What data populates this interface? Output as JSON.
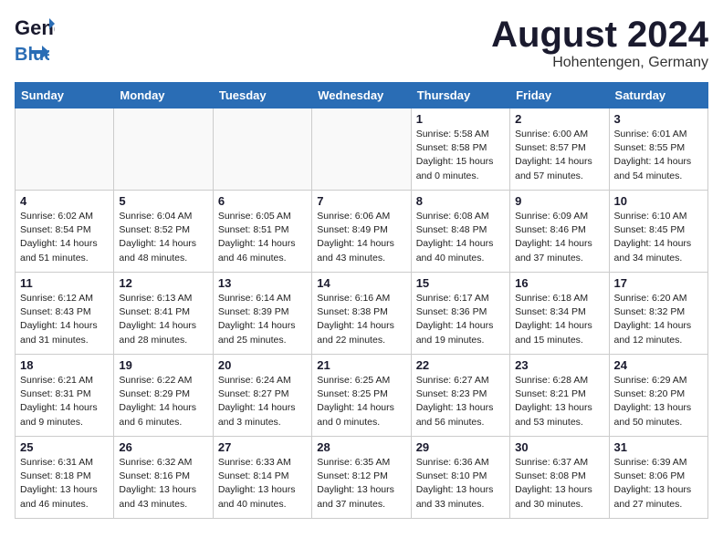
{
  "logo": {
    "line1": "General",
    "line2": "Blue"
  },
  "title": "August 2024",
  "location": "Hohentengen, Germany",
  "days_of_week": [
    "Sunday",
    "Monday",
    "Tuesday",
    "Wednesday",
    "Thursday",
    "Friday",
    "Saturday"
  ],
  "weeks": [
    [
      {
        "day": "",
        "info": ""
      },
      {
        "day": "",
        "info": ""
      },
      {
        "day": "",
        "info": ""
      },
      {
        "day": "",
        "info": ""
      },
      {
        "day": "1",
        "info": "Sunrise: 5:58 AM\nSunset: 8:58 PM\nDaylight: 15 hours\nand 0 minutes."
      },
      {
        "day": "2",
        "info": "Sunrise: 6:00 AM\nSunset: 8:57 PM\nDaylight: 14 hours\nand 57 minutes."
      },
      {
        "day": "3",
        "info": "Sunrise: 6:01 AM\nSunset: 8:55 PM\nDaylight: 14 hours\nand 54 minutes."
      }
    ],
    [
      {
        "day": "4",
        "info": "Sunrise: 6:02 AM\nSunset: 8:54 PM\nDaylight: 14 hours\nand 51 minutes."
      },
      {
        "day": "5",
        "info": "Sunrise: 6:04 AM\nSunset: 8:52 PM\nDaylight: 14 hours\nand 48 minutes."
      },
      {
        "day": "6",
        "info": "Sunrise: 6:05 AM\nSunset: 8:51 PM\nDaylight: 14 hours\nand 46 minutes."
      },
      {
        "day": "7",
        "info": "Sunrise: 6:06 AM\nSunset: 8:49 PM\nDaylight: 14 hours\nand 43 minutes."
      },
      {
        "day": "8",
        "info": "Sunrise: 6:08 AM\nSunset: 8:48 PM\nDaylight: 14 hours\nand 40 minutes."
      },
      {
        "day": "9",
        "info": "Sunrise: 6:09 AM\nSunset: 8:46 PM\nDaylight: 14 hours\nand 37 minutes."
      },
      {
        "day": "10",
        "info": "Sunrise: 6:10 AM\nSunset: 8:45 PM\nDaylight: 14 hours\nand 34 minutes."
      }
    ],
    [
      {
        "day": "11",
        "info": "Sunrise: 6:12 AM\nSunset: 8:43 PM\nDaylight: 14 hours\nand 31 minutes."
      },
      {
        "day": "12",
        "info": "Sunrise: 6:13 AM\nSunset: 8:41 PM\nDaylight: 14 hours\nand 28 minutes."
      },
      {
        "day": "13",
        "info": "Sunrise: 6:14 AM\nSunset: 8:39 PM\nDaylight: 14 hours\nand 25 minutes."
      },
      {
        "day": "14",
        "info": "Sunrise: 6:16 AM\nSunset: 8:38 PM\nDaylight: 14 hours\nand 22 minutes."
      },
      {
        "day": "15",
        "info": "Sunrise: 6:17 AM\nSunset: 8:36 PM\nDaylight: 14 hours\nand 19 minutes."
      },
      {
        "day": "16",
        "info": "Sunrise: 6:18 AM\nSunset: 8:34 PM\nDaylight: 14 hours\nand 15 minutes."
      },
      {
        "day": "17",
        "info": "Sunrise: 6:20 AM\nSunset: 8:32 PM\nDaylight: 14 hours\nand 12 minutes."
      }
    ],
    [
      {
        "day": "18",
        "info": "Sunrise: 6:21 AM\nSunset: 8:31 PM\nDaylight: 14 hours\nand 9 minutes."
      },
      {
        "day": "19",
        "info": "Sunrise: 6:22 AM\nSunset: 8:29 PM\nDaylight: 14 hours\nand 6 minutes."
      },
      {
        "day": "20",
        "info": "Sunrise: 6:24 AM\nSunset: 8:27 PM\nDaylight: 14 hours\nand 3 minutes."
      },
      {
        "day": "21",
        "info": "Sunrise: 6:25 AM\nSunset: 8:25 PM\nDaylight: 14 hours\nand 0 minutes."
      },
      {
        "day": "22",
        "info": "Sunrise: 6:27 AM\nSunset: 8:23 PM\nDaylight: 13 hours\nand 56 minutes."
      },
      {
        "day": "23",
        "info": "Sunrise: 6:28 AM\nSunset: 8:21 PM\nDaylight: 13 hours\nand 53 minutes."
      },
      {
        "day": "24",
        "info": "Sunrise: 6:29 AM\nSunset: 8:20 PM\nDaylight: 13 hours\nand 50 minutes."
      }
    ],
    [
      {
        "day": "25",
        "info": "Sunrise: 6:31 AM\nSunset: 8:18 PM\nDaylight: 13 hours\nand 46 minutes."
      },
      {
        "day": "26",
        "info": "Sunrise: 6:32 AM\nSunset: 8:16 PM\nDaylight: 13 hours\nand 43 minutes."
      },
      {
        "day": "27",
        "info": "Sunrise: 6:33 AM\nSunset: 8:14 PM\nDaylight: 13 hours\nand 40 minutes."
      },
      {
        "day": "28",
        "info": "Sunrise: 6:35 AM\nSunset: 8:12 PM\nDaylight: 13 hours\nand 37 minutes."
      },
      {
        "day": "29",
        "info": "Sunrise: 6:36 AM\nSunset: 8:10 PM\nDaylight: 13 hours\nand 33 minutes."
      },
      {
        "day": "30",
        "info": "Sunrise: 6:37 AM\nSunset: 8:08 PM\nDaylight: 13 hours\nand 30 minutes."
      },
      {
        "day": "31",
        "info": "Sunrise: 6:39 AM\nSunset: 8:06 PM\nDaylight: 13 hours\nand 27 minutes."
      }
    ]
  ]
}
